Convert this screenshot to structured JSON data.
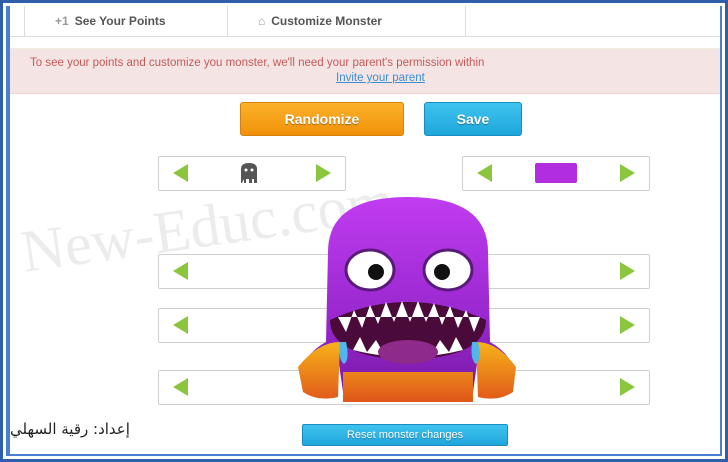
{
  "tabs": [
    {
      "label": "See Your Points",
      "icon": "+1"
    },
    {
      "label": "Customize Monster",
      "icon": "house-icon"
    }
  ],
  "notice": {
    "message": "To see your points and customize you monster, we'll need your parent's permission within",
    "link": "Invite your parent"
  },
  "actions": {
    "randomize": "Randomize",
    "save": "Save",
    "reset": "Reset monster changes"
  },
  "watermark": "New-Educ.com",
  "credit": "إعداد: رقية السهلي",
  "colors": {
    "monster_primary": "#b02ee0",
    "arrow": "#8cc63f",
    "randomize": "#f0920a",
    "save": "#1fa6dc"
  }
}
